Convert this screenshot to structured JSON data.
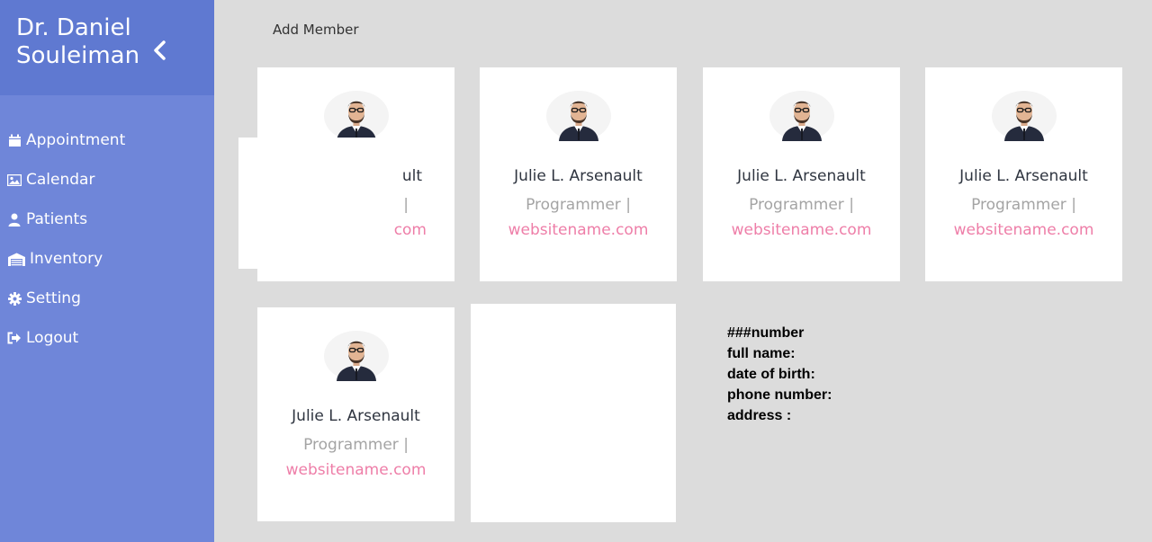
{
  "sidebar": {
    "doctor_name_line1": "Dr. Daniel",
    "doctor_name_line2": "Souleiman",
    "items": [
      {
        "label": "Appointment",
        "icon": "calendar-icon"
      },
      {
        "label": "Calendar",
        "icon": "image-icon"
      },
      {
        "label": "Patients",
        "icon": "user-icon"
      },
      {
        "label": "Inventory",
        "icon": "warehouse-icon"
      },
      {
        "label": "Setting",
        "icon": "gear-icon"
      },
      {
        "label": "Logout",
        "icon": "logout-icon"
      }
    ]
  },
  "main": {
    "add_member_label": "Add Member",
    "cards": [
      {
        "name": "ult",
        "role": "|",
        "site": "com"
      },
      {
        "name": "Julie L. Arsenault",
        "role": "Programmer |",
        "site": "websitename.com"
      },
      {
        "name": "Julie L. Arsenault",
        "role": "Programmer |",
        "site": "websitename.com"
      },
      {
        "name": "Julie L. Arsenault",
        "role": "Programmer |",
        "site": "websitename.com"
      },
      {
        "name": "Julie L. Arsenault",
        "role": "Programmer |",
        "site": "websitename.com"
      }
    ],
    "details": {
      "line1": "###number",
      "line2": "full name:",
      "line3": "date of birth:",
      "line4": "phone number:",
      "line5": "address :"
    }
  },
  "colors": {
    "sidebar": "#6f86d9",
    "sidebar_header": "#5f79d1",
    "background": "#dcdcdc",
    "link": "#ee7ea8"
  }
}
